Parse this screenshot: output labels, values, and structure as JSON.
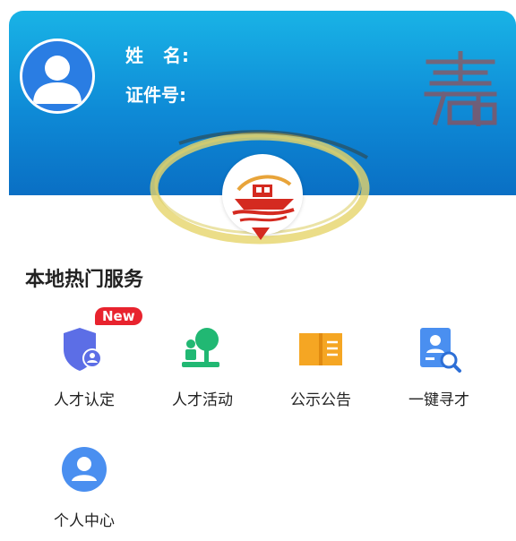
{
  "profile": {
    "name_label": "姓　名:",
    "id_label": "证件号:"
  },
  "section": {
    "title": "本地热门服务"
  },
  "services": [
    {
      "label": "人才认定",
      "icon": "shield-user-icon",
      "badge": "New"
    },
    {
      "label": "人才活动",
      "icon": "person-tree-icon"
    },
    {
      "label": "公示公告",
      "icon": "open-book-icon"
    },
    {
      "label": "一键寻才",
      "icon": "search-profile-icon"
    },
    {
      "label": "个人中心",
      "icon": "user-circle-icon"
    }
  ],
  "colors": {
    "banner_top": "#19b3e6",
    "banner_bottom": "#0a6fc4",
    "badge_red": "#e8232e",
    "ring_yellow": "#e6d56a"
  }
}
